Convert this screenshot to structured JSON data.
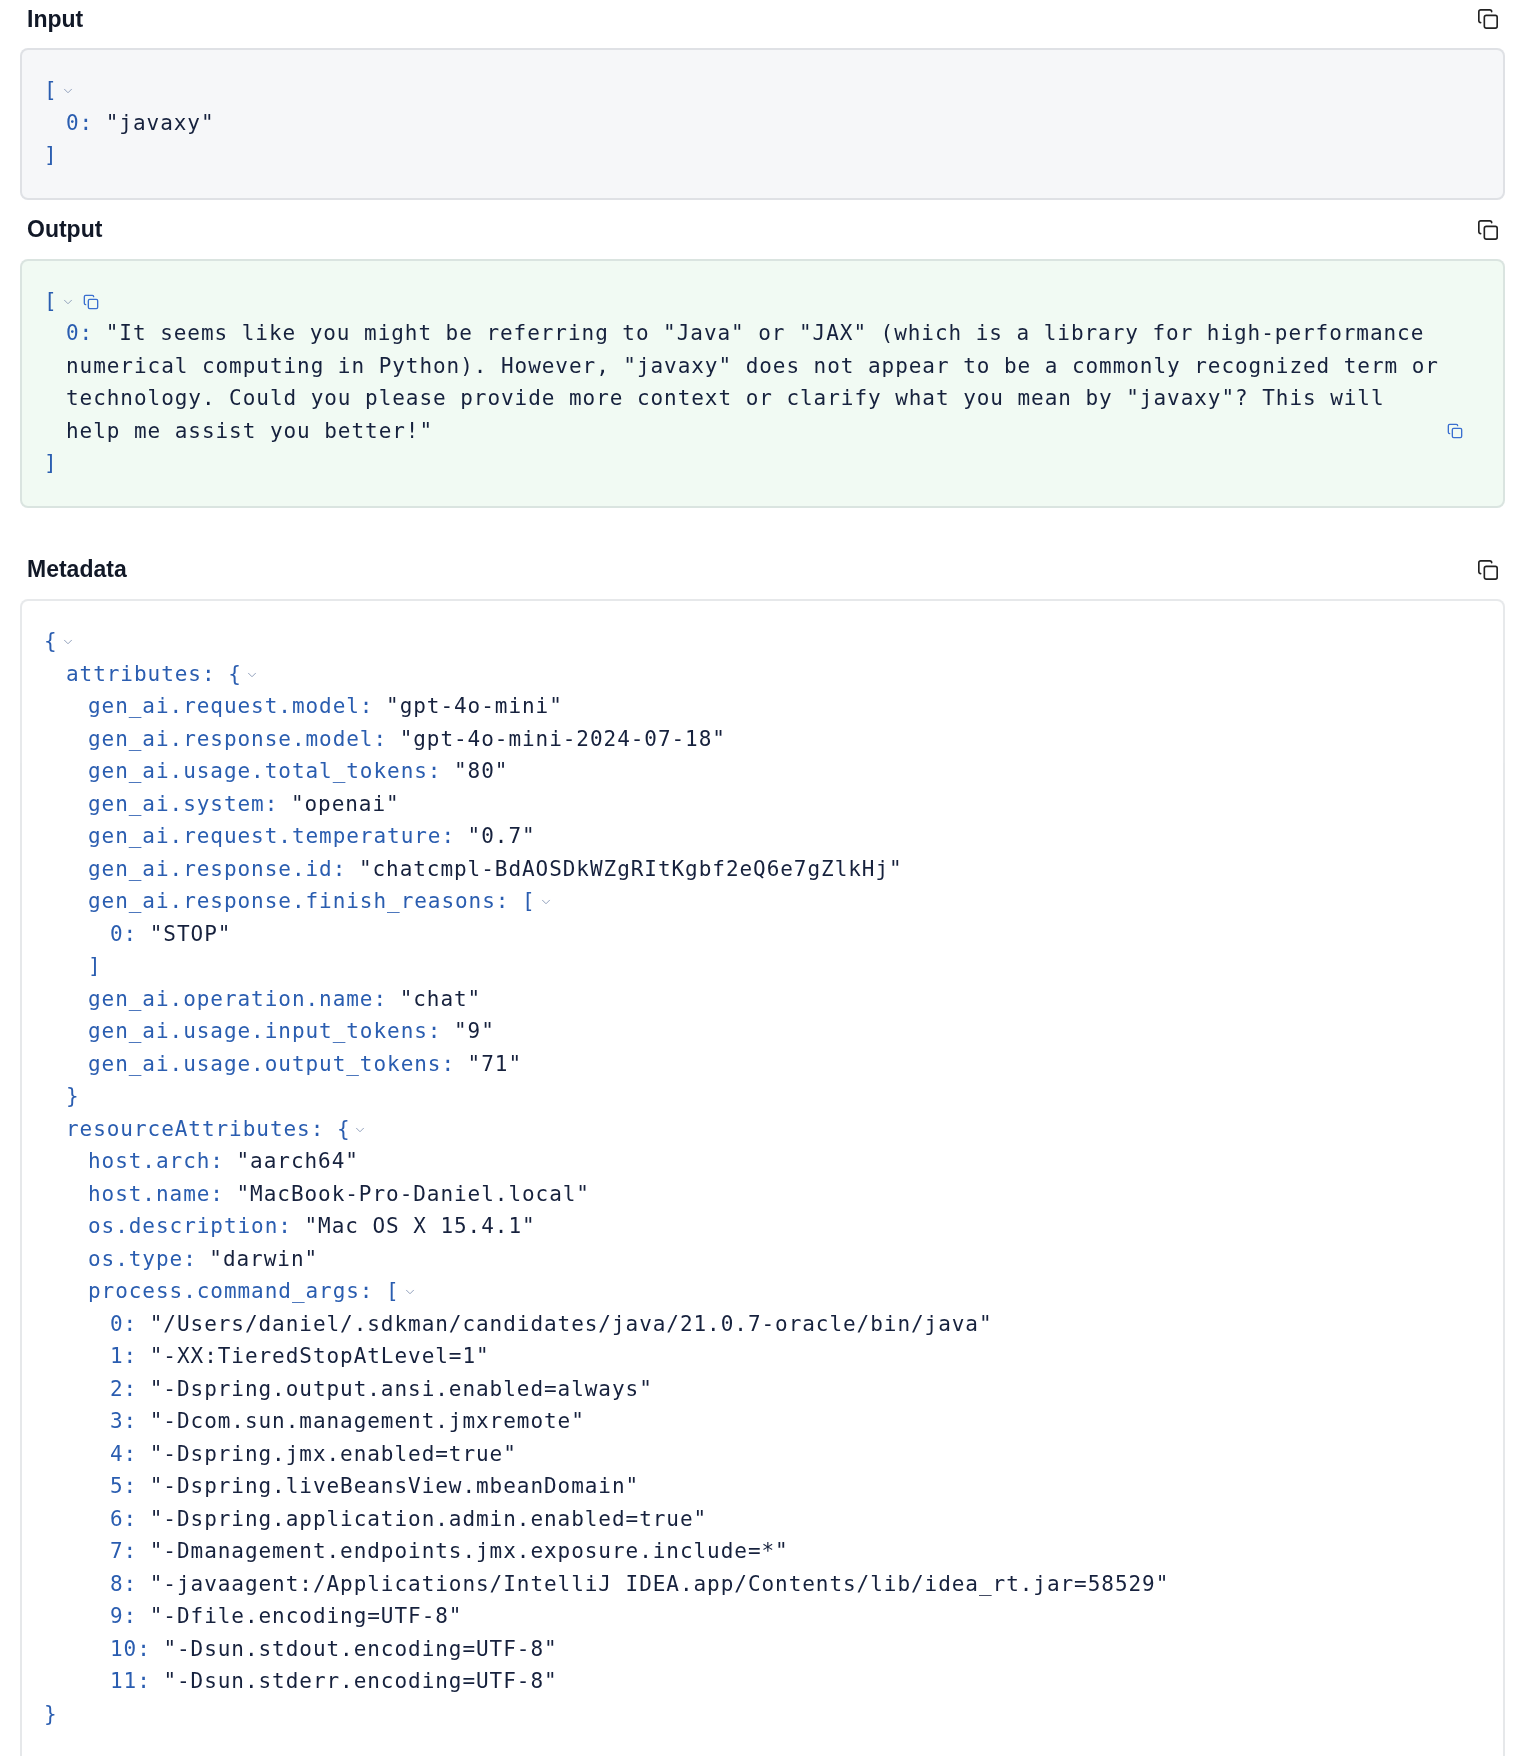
{
  "sections": [
    {
      "title": "Input",
      "color": "#f6f7f9",
      "tree": {
        "open": "[",
        "close": "]",
        "expanded": true,
        "children": [
          {
            "key": "0:",
            "value": "\"javaxy\""
          }
        ]
      }
    },
    {
      "title": "Output",
      "color": "#f1faf3",
      "tree": {
        "open": "[",
        "close": "]",
        "expanded": true,
        "copyable": true,
        "children": [
          {
            "key": "0:",
            "value": "\"It seems like you might be referring to \"Java\" or \"JAX\" (which is a library for high-performance numerical computing in Python). However, \"javaxy\" does not appear to be a commonly recognized term or technology. Could you please provide more context or clarify what you mean by \"javaxy\"? This will help me assist you better!\"",
            "copyable": true
          }
        ]
      }
    },
    {
      "title": "Metadata",
      "color": "#ffffff",
      "tree": {
        "open": "{",
        "close": "}",
        "expanded": true,
        "children": [
          {
            "key": "attributes:",
            "open": "{",
            "close": "}",
            "expanded": true,
            "children": [
              {
                "key": "gen_ai.request.model:",
                "value": "\"gpt-4o-mini\""
              },
              {
                "key": "gen_ai.response.model:",
                "value": "\"gpt-4o-mini-2024-07-18\""
              },
              {
                "key": "gen_ai.usage.total_tokens:",
                "value": "\"80\""
              },
              {
                "key": "gen_ai.system:",
                "value": "\"openai\""
              },
              {
                "key": "gen_ai.request.temperature:",
                "value": "\"0.7\""
              },
              {
                "key": "gen_ai.response.id:",
                "value": "\"chatcmpl-BdAOSDkWZgRItKgbf2eQ6e7gZlkHj\""
              },
              {
                "key": "gen_ai.response.finish_reasons:",
                "open": "[",
                "close": "]",
                "expanded": true,
                "children": [
                  {
                    "key": "0:",
                    "value": "\"STOP\""
                  }
                ]
              },
              {
                "key": "gen_ai.operation.name:",
                "value": "\"chat\""
              },
              {
                "key": "gen_ai.usage.input_tokens:",
                "value": "\"9\""
              },
              {
                "key": "gen_ai.usage.output_tokens:",
                "value": "\"71\""
              }
            ]
          },
          {
            "key": "resourceAttributes:",
            "open": "{",
            "expanded": true,
            "children": [
              {
                "key": "host.arch:",
                "value": "\"aarch64\""
              },
              {
                "key": "host.name:",
                "value": "\"MacBook-Pro-Daniel.local\""
              },
              {
                "key": "os.description:",
                "value": "\"Mac OS X 15.4.1\""
              },
              {
                "key": "os.type:",
                "value": "\"darwin\""
              },
              {
                "key": "process.command_args:",
                "open": "[",
                "expanded": true,
                "children": [
                  {
                    "key": "0:",
                    "value": "\"/Users/daniel/.sdkman/candidates/java/21.0.7-oracle/bin/java\""
                  },
                  {
                    "key": "1:",
                    "value": "\"-XX:TieredStopAtLevel=1\""
                  },
                  {
                    "key": "2:",
                    "value": "\"-Dspring.output.ansi.enabled=always\""
                  },
                  {
                    "key": "3:",
                    "value": "\"-Dcom.sun.management.jmxremote\""
                  },
                  {
                    "key": "4:",
                    "value": "\"-Dspring.jmx.enabled=true\""
                  },
                  {
                    "key": "5:",
                    "value": "\"-Dspring.liveBeansView.mbeanDomain\""
                  },
                  {
                    "key": "6:",
                    "value": "\"-Dspring.application.admin.enabled=true\""
                  },
                  {
                    "key": "7:",
                    "value": "\"-Dmanagement.endpoints.jmx.exposure.include=*\""
                  },
                  {
                    "key": "8:",
                    "value": "\"-javaagent:/Applications/IntelliJ IDEA.app/Contents/lib/idea_rt.jar=58529\""
                  },
                  {
                    "key": "9:",
                    "value": "\"-Dfile.encoding=UTF-8\""
                  },
                  {
                    "key": "10:",
                    "value": "\"-Dsun.stdout.encoding=UTF-8\""
                  },
                  {
                    "key": "11:",
                    "value": "\"-Dsun.stderr.encoding=UTF-8\""
                  }
                ]
              }
            ]
          }
        ]
      }
    }
  ]
}
